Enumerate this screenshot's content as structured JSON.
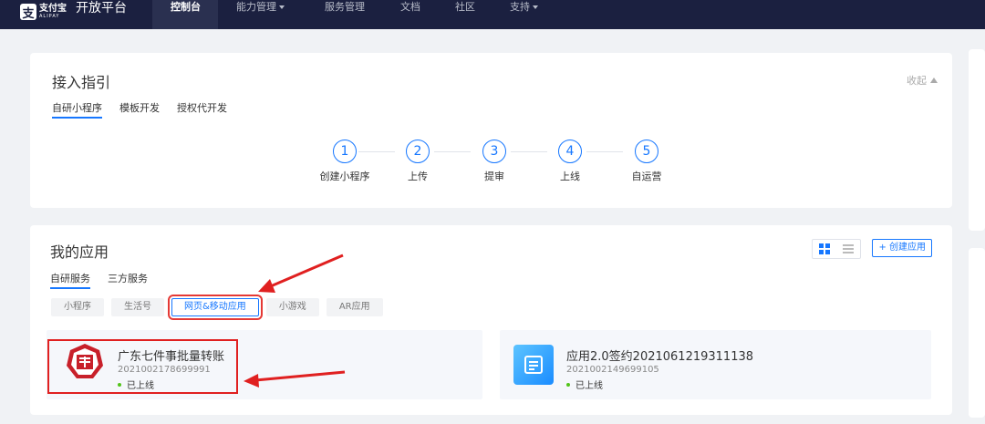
{
  "nav": {
    "logo_cn": "支付宝",
    "logo_en": "ALIPAY",
    "platform": "开放平台",
    "items": [
      {
        "label": "控制台",
        "active": true,
        "dropdown": false
      },
      {
        "label": "能力管理",
        "active": false,
        "dropdown": true
      },
      {
        "label": "服务管理",
        "active": false,
        "dropdown": false
      },
      {
        "label": "文档",
        "active": false,
        "dropdown": false
      },
      {
        "label": "社区",
        "active": false,
        "dropdown": false
      },
      {
        "label": "支持",
        "active": false,
        "dropdown": true
      }
    ]
  },
  "guide": {
    "title": "接入指引",
    "collapse_label": "收起",
    "tabs": [
      "自研小程序",
      "模板开发",
      "授权代开发"
    ],
    "steps": [
      {
        "num": "1",
        "label": "创建小程序"
      },
      {
        "num": "2",
        "label": "上传"
      },
      {
        "num": "3",
        "label": "提审"
      },
      {
        "num": "4",
        "label": "上线"
      },
      {
        "num": "5",
        "label": "自运营"
      }
    ]
  },
  "apps": {
    "title": "我的应用",
    "create_label": "+ 创建应用",
    "tabs": [
      "自研服务",
      "三方服务"
    ],
    "filters": [
      "小程序",
      "生活号",
      "网页&移动应用",
      "小游戏",
      "AR应用"
    ],
    "active_filter": "网页&移动应用",
    "items": [
      {
        "name": "广东七件事批量转账",
        "id": "2021002178699991",
        "status": "已上线"
      },
      {
        "name": "应用2.0签约2021061219311138",
        "id": "2021002149699105",
        "status": "已上线"
      }
    ]
  },
  "colors": {
    "nav_bg": "#1b2040",
    "accent": "#1677ff",
    "highlight": "#e02020",
    "online": "#52c41a"
  }
}
